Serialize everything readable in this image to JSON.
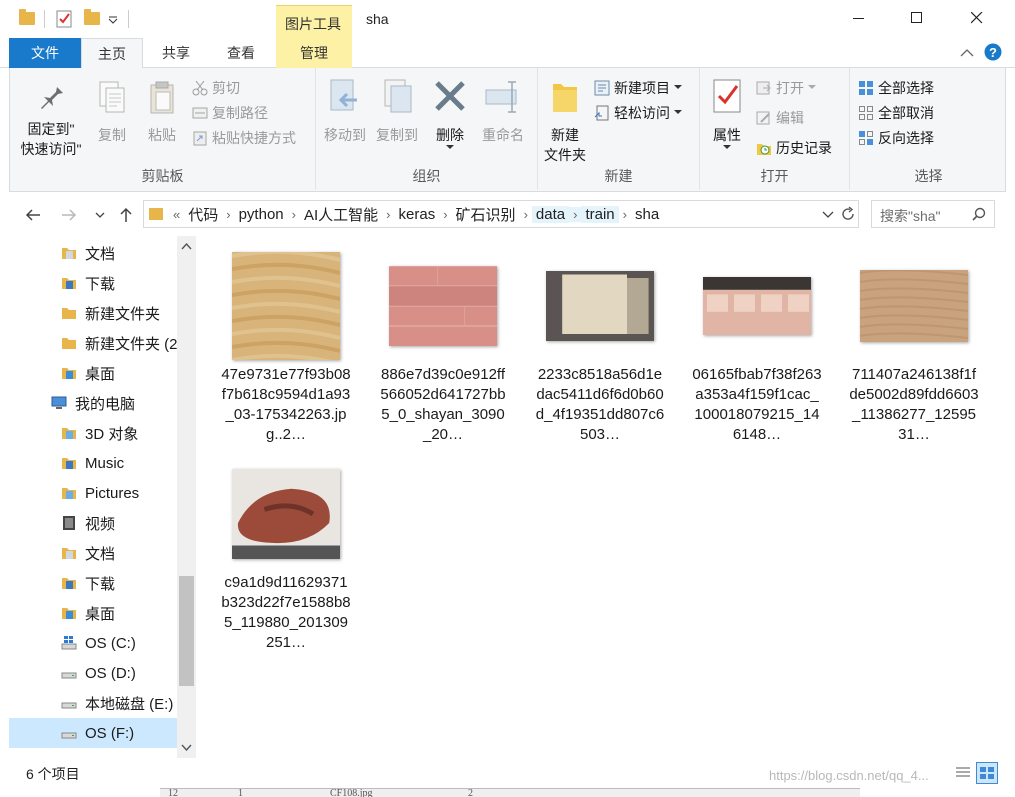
{
  "window": {
    "title": "sha",
    "context_tab_header": "图片工具"
  },
  "tabs": {
    "file": "文件",
    "home": "主页",
    "share": "共享",
    "view": "查看",
    "manage": "管理"
  },
  "ribbon": {
    "clipboard": {
      "label": "剪贴板",
      "pin": "固定到\"",
      "pin2": "快速访问\"",
      "copy": "复制",
      "paste": "粘贴",
      "cut": "剪切",
      "copy_path": "复制路径",
      "paste_shortcut": "粘贴快捷方式"
    },
    "organize": {
      "label": "组织",
      "move_to": "移动到",
      "copy_to": "复制到",
      "delete": "删除",
      "rename": "重命名"
    },
    "new": {
      "label": "新建",
      "new_folder": "新建",
      "new_folder2": "文件夹",
      "new_item": "新建项目",
      "easy_access": "轻松访问"
    },
    "open": {
      "label": "打开",
      "properties": "属性",
      "open": "打开",
      "edit": "编辑",
      "history": "历史记录"
    },
    "select": {
      "label": "选择",
      "select_all": "全部选择",
      "select_none": "全部取消",
      "invert": "反向选择"
    }
  },
  "address": {
    "overflow": "«",
    "crumbs": [
      "代码",
      "python",
      "AI人工智能",
      "keras",
      "矿石识别",
      "data",
      "train",
      "sha"
    ],
    "search_placeholder": "搜索\"sha\""
  },
  "nav": {
    "items": [
      {
        "label": "文档",
        "icon": "documents-icon"
      },
      {
        "label": "下载",
        "icon": "download-icon"
      },
      {
        "label": "新建文件夹",
        "icon": "folder-icon"
      },
      {
        "label": "新建文件夹 (2",
        "icon": "folder-icon"
      },
      {
        "label": "桌面",
        "icon": "desktop-icon"
      },
      {
        "label": "我的电脑",
        "icon": "pc-icon"
      },
      {
        "label": "3D 对象",
        "icon": "3d-objects-icon"
      },
      {
        "label": "Music",
        "icon": "music-icon"
      },
      {
        "label": "Pictures",
        "icon": "pictures-icon"
      },
      {
        "label": "视频",
        "icon": "video-icon"
      },
      {
        "label": "文档",
        "icon": "documents-icon"
      },
      {
        "label": "下载",
        "icon": "download-icon"
      },
      {
        "label": "桌面",
        "icon": "desktop-icon"
      },
      {
        "label": "OS (C:)",
        "icon": "windows-drive-icon"
      },
      {
        "label": "OS (D:)",
        "icon": "drive-icon"
      },
      {
        "label": "本地磁盘 (E:)",
        "icon": "drive-icon"
      },
      {
        "label": "OS (F:)",
        "icon": "drive-icon"
      }
    ]
  },
  "files": [
    {
      "name": "47e9731e77f93b08f7b618c9594d1a93_03-175342263.jpg..2…",
      "colors": [
        "#d9b47a",
        "#c69a5c",
        "#e2c898"
      ]
    },
    {
      "name": "886e7d39c0e912ff566052d641727bb5_0_shayan_3090_20…",
      "colors": [
        "#d78f88",
        "#c47a74",
        "#e0a29c"
      ]
    },
    {
      "name": "2233c8518a56d1edac5411d6f6d0b60d_4f19351dd807c6503…",
      "colors": [
        "#5a5552",
        "#e2d8c2",
        "#c9bda5"
      ]
    },
    {
      "name": "06165fbab7f38f263a353a4f159f1cac_100018079215_146148…",
      "colors": [
        "#3b3533",
        "#e0b5a5",
        "#f0d2c4"
      ]
    },
    {
      "name": "711407a246138f1fde5002d89fdd6603_11386277_1259531…",
      "colors": [
        "#c9a27e",
        "#b88f6a",
        "#d8b894"
      ]
    },
    {
      "name": "c9a1d9d11629371b323d22f7e1588b85_119880_201309251…",
      "colors": [
        "#e9e6e2",
        "#9c4b3a",
        "#6e3228"
      ]
    }
  ],
  "status": {
    "count": "6 个项目",
    "watermark": "https://blog.csdn.net/qq_4..."
  },
  "bottom_strip": [
    "12",
    "1",
    "CF108.jpg",
    "2"
  ]
}
